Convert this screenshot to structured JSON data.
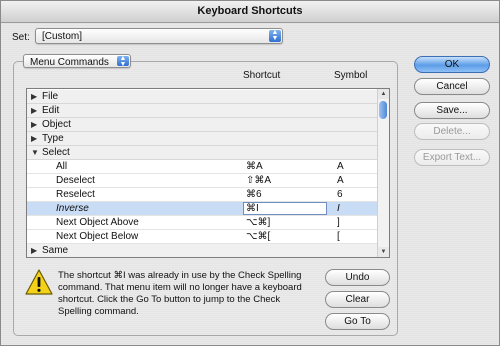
{
  "window": {
    "title": "Keyboard Shortcuts"
  },
  "set": {
    "label": "Set:",
    "value": "[Custom]"
  },
  "filter": {
    "value": "Menu Commands"
  },
  "columns": {
    "shortcut": "Shortcut",
    "symbol": "Symbol"
  },
  "rows": [
    {
      "kind": "group",
      "expanded": false,
      "name": "File"
    },
    {
      "kind": "group",
      "expanded": false,
      "name": "Edit"
    },
    {
      "kind": "group",
      "expanded": false,
      "name": "Object"
    },
    {
      "kind": "group",
      "expanded": false,
      "name": "Type"
    },
    {
      "kind": "group",
      "expanded": true,
      "name": "Select"
    },
    {
      "kind": "command",
      "name": "All",
      "shortcut": "⌘A",
      "symbol": "A"
    },
    {
      "kind": "command",
      "name": "Deselect",
      "shortcut": "⇧⌘A",
      "symbol": "A"
    },
    {
      "kind": "command",
      "name": "Reselect",
      "shortcut": "⌘6",
      "symbol": "6"
    },
    {
      "kind": "command",
      "name": "Inverse",
      "shortcut": "⌘I",
      "symbol": "I",
      "selected": true
    },
    {
      "kind": "command",
      "name": "Next Object Above",
      "shortcut": "⌥⌘]",
      "symbol": "]"
    },
    {
      "kind": "command",
      "name": "Next Object Below",
      "shortcut": "⌥⌘[",
      "symbol": "["
    },
    {
      "kind": "group",
      "expanded": false,
      "name": "Same"
    }
  ],
  "message": "The shortcut ⌘I was already in use by the Check Spelling command.  That menu item will no longer have a keyboard shortcut. Click the Go To button to jump to the Check Spelling command.",
  "buttons": {
    "ok": "OK",
    "cancel": "Cancel",
    "save": "Save...",
    "delete": "Delete...",
    "export": "Export Text...",
    "undo": "Undo",
    "clear": "Clear",
    "goto": "Go To"
  },
  "icons": {
    "warning": "warning-triangle-icon",
    "popup_arrows": "updown-arrows-icon",
    "disclosure": "disclosure-triangle-icon"
  },
  "colors": {
    "accent": "#5c9de8",
    "selection": "#c9dcf6",
    "warning": "#f5d21a"
  }
}
